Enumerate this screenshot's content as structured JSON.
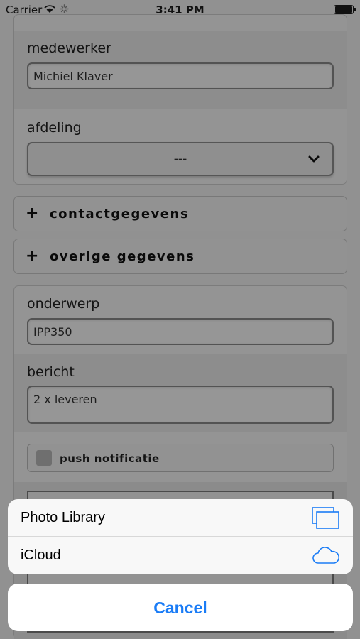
{
  "status_bar": {
    "carrier": "Carrier",
    "time": "3:41 PM",
    "wifi_icon": "wifi-icon",
    "activity_icon": "activity-spinner-icon",
    "battery_icon": "battery-icon"
  },
  "form": {
    "employee_label": "medewerker",
    "employee_value": "Michiel Klaver",
    "department_label": "afdeling",
    "department_value": "---",
    "contact_toggle_symbol": "+",
    "contact_label": "contactgegevens",
    "other_toggle_symbol": "+",
    "other_label": "overige gegevens",
    "subject_label": "onderwerp",
    "subject_value": "IPP350",
    "message_label": "bericht",
    "message_value": "2 x leveren",
    "push_label": "push notificatie"
  },
  "action_sheet": {
    "items": [
      {
        "label": "Photo Library",
        "icon": "photo-library-icon"
      },
      {
        "label": "iCloud",
        "icon": "icloud-icon"
      }
    ],
    "cancel_label": "Cancel"
  },
  "colors": {
    "accent": "#1a7cf6",
    "overlay": "#000000"
  }
}
